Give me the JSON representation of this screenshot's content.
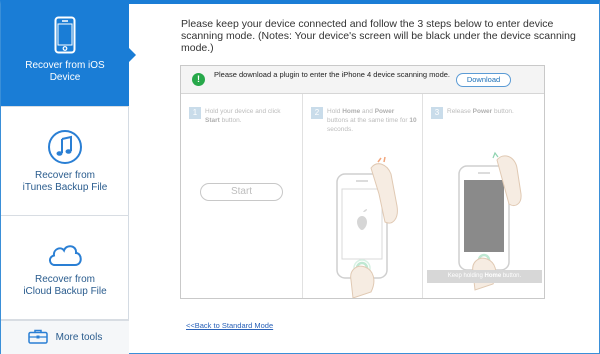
{
  "sidebar": {
    "items": [
      {
        "label_line1": "Recover from iOS",
        "label_line2": "Device",
        "icon": "phone-icon",
        "active": true
      },
      {
        "label_line1": "Recover from",
        "label_line2": "iTunes Backup File",
        "icon": "music-note-icon",
        "active": false
      },
      {
        "label_line1": "Recover from",
        "label_line2": "iCloud Backup File",
        "icon": "cloud-icon",
        "active": false
      }
    ],
    "more_tools": {
      "label": "More tools",
      "icon": "toolbox-icon"
    }
  },
  "main": {
    "instruction": "Please keep your device connected and follow the 3 steps below to enter device scanning mode. (Notes: Your device's screen will be black under the device scanning mode.)",
    "notice": {
      "text": "Please download a plugin to enter the iPhone 4 device scanning mode.",
      "button": "Download"
    },
    "steps": [
      {
        "num": "1",
        "text_a": "Hold your device and click ",
        "bold_a": "Start",
        "text_b": " button.",
        "text_c": "",
        "bold_b": "",
        "text_d": "",
        "button": "Start"
      },
      {
        "num": "2",
        "text_a": "Hold ",
        "bold_a": "Home",
        "text_b": " and ",
        "bold_b": "Power",
        "text_c": " buttons at the same time for ",
        "bold_c": "10",
        "text_d": " seconds."
      },
      {
        "num": "3",
        "text_a": "Release ",
        "bold_a": "Power",
        "text_b": " button.",
        "hold_prefix": "Keep holding ",
        "hold_bold": "Home",
        "hold_suffix": " button."
      }
    ],
    "back_link": "<<Back to Standard Mode"
  },
  "colors": {
    "accent": "#1a7dd6",
    "notice_icon": "#27a84a",
    "link": "#2a62b8"
  }
}
